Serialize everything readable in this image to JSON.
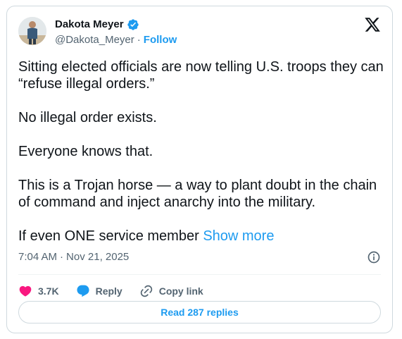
{
  "author": {
    "name": "Dakota Meyer",
    "handle": "@Dakota_Meyer",
    "separator": "·",
    "follow_label": "Follow",
    "verified_icon": "verified-badge-icon"
  },
  "platform_icon": "x-logo-icon",
  "tweet": {
    "paragraphs": [
      "Sitting elected officials are now telling U.S. troops they can “refuse illegal orders.”",
      "No illegal order exists.",
      "Everyone knows that.",
      "This is a Trojan horse — a way to plant doubt in the chain of command and inject anarchy into the military.",
      "If even ONE service member"
    ],
    "show_more_label": "Show more"
  },
  "meta": {
    "time": "7:04 AM",
    "separator": "·",
    "date": "Nov 21, 2025"
  },
  "actions": {
    "like_count": "3.7K",
    "reply_label": "Reply",
    "copy_link_label": "Copy link"
  },
  "read_replies_label": "Read 287 replies",
  "colors": {
    "accent": "#1d9bf0",
    "like": "#f91880",
    "text": "#0f1419",
    "muted": "#536471",
    "border": "#cfd9de"
  }
}
